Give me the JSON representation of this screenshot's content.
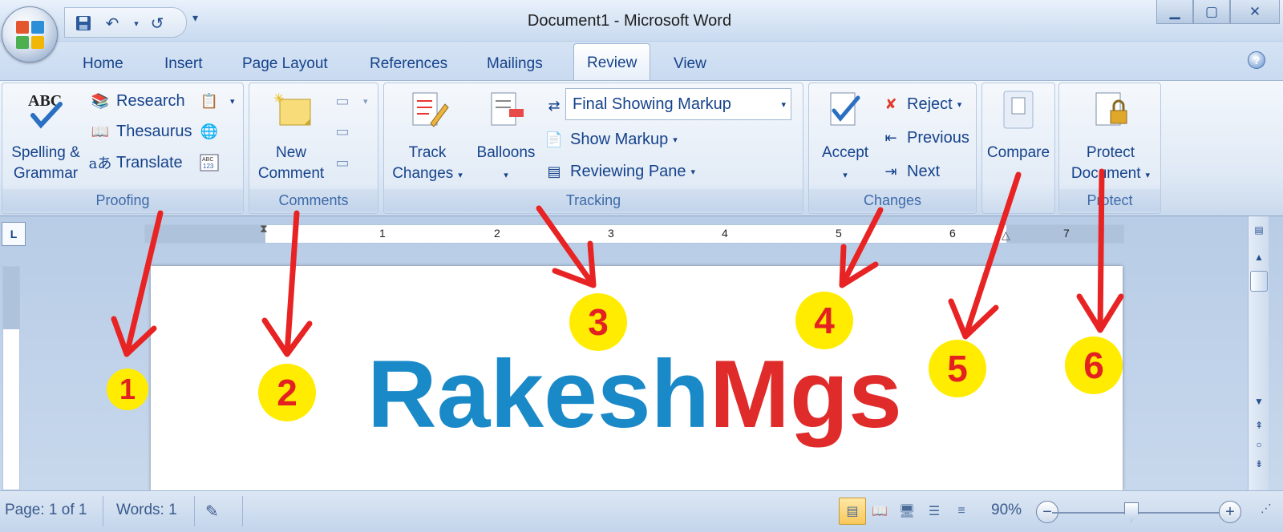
{
  "window": {
    "title": "Document1 - Microsoft Word",
    "controls": [
      "minimize-icon",
      "maximize-icon",
      "close-icon"
    ]
  },
  "quick_access": [
    "save-icon",
    "undo-icon",
    "redo-icon",
    "customize-icon"
  ],
  "tabs": [
    {
      "label": "Home"
    },
    {
      "label": "Insert"
    },
    {
      "label": "Page Layout"
    },
    {
      "label": "References"
    },
    {
      "label": "Mailings"
    },
    {
      "label": "Review",
      "active": true
    },
    {
      "label": "View"
    }
  ],
  "ribbon": {
    "proofing": {
      "label": "Proofing",
      "spelling": "Spelling &\nGrammar",
      "research": "Research",
      "thesaurus": "Thesaurus",
      "translate": "Translate"
    },
    "comments": {
      "label": "Comments",
      "new_comment": "New\nComment"
    },
    "tracking": {
      "label": "Tracking",
      "track_changes": "Track\nChanges",
      "balloons": "Balloons",
      "markup_mode": "Final Showing Markup",
      "show_markup": "Show Markup",
      "reviewing_pane": "Reviewing Pane"
    },
    "changes": {
      "label": "Changes",
      "accept": "Accept",
      "reject": "Reject",
      "previous": "Previous",
      "next": "Next"
    },
    "compare": {
      "compare": "Compare"
    },
    "protect": {
      "label": "Protect",
      "protect_document": "Protect\nDocument"
    }
  },
  "ruler": {
    "numbers": [
      "1",
      "2",
      "3",
      "4",
      "5",
      "6",
      "7"
    ]
  },
  "document": {
    "text_part1": "Rakesh",
    "text_part2": "Mgs",
    "color_part1": "#1a89c8",
    "color_part2": "#e02b2b"
  },
  "status_bar": {
    "page": "Page: 1 of 1",
    "words": "Words: 1",
    "zoom": "90%"
  },
  "annotations": [
    {
      "label": "1"
    },
    {
      "label": "2"
    },
    {
      "label": "3"
    },
    {
      "label": "4"
    },
    {
      "label": "5"
    },
    {
      "label": "6"
    }
  ],
  "accent_colors": {
    "arrow": "#e82323",
    "marker_fill": "#ffec00",
    "marker_text": "#e32121"
  }
}
